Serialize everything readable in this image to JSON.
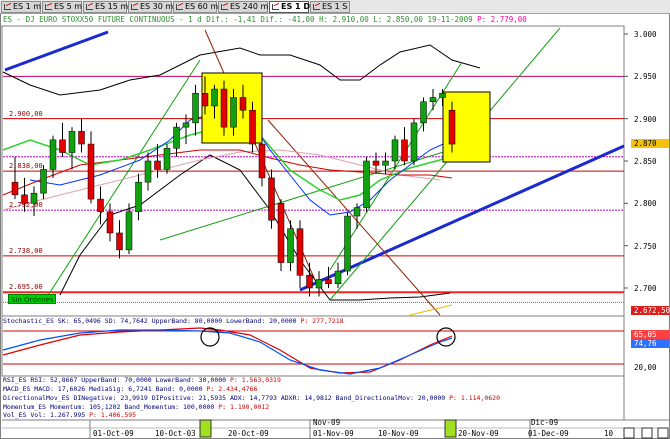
{
  "tabs": [
    {
      "label": "ES 1 m",
      "active": false
    },
    {
      "label": "ES 5 m",
      "active": false
    },
    {
      "label": "ES 15 m",
      "active": false
    },
    {
      "label": "ES 30 m",
      "active": false
    },
    {
      "label": "ES 60 m",
      "active": false
    },
    {
      "label": "ES 240 m",
      "active": false
    },
    {
      "label": "ES 1 D",
      "active": true
    },
    {
      "label": "ES 1 S",
      "active": false
    }
  ],
  "header": {
    "prefix": "ES - DJ EURO STOXX50 FUTURE CONTINUOUS - 1 d Dif.: -1,41 Dif.: -41,00 H: 2.910,00 L: 2.850,00 19-11-2009",
    "price": "P: 2.779,00"
  },
  "price_axis": {
    "labels": [
      "3.000",
      "2.950",
      "2.900",
      "2.850",
      "2.800",
      "2.750",
      "2.700"
    ],
    "tag_current": "2.870",
    "tag_low": "2.672,50",
    "current_color": "#f4c20d",
    "low_color": "#d82020"
  },
  "levels": {
    "labels": [
      "2.900,00",
      "2.838,00",
      "2.792,00",
      "2.738,00",
      "2.695,00"
    ]
  },
  "sin_ordenes": "Sin Ordenes",
  "stoch": {
    "label": "Stochastic_ES SK:",
    "sk": "65,0496",
    "sd": "SD: 74,7642",
    "upper": "UpperBand: 80,0000",
    "lower": "LowerBand: 20,0000",
    "p": "P: 277,7218",
    "tag1": "65,05",
    "tag2": "74,76"
  },
  "macd": {
    "label": "MACD_ES MACD: 17,6026 MediaSig: 6,7241 Band: 0,0000",
    "tag": "20,00",
    "p": "P: 2.434,4766"
  },
  "indicators": [
    {
      "text": "RSI_ES RSI: 52,8667 UpperBand: 70,0000 LowerBand: 30,0000",
      "p": "P: 1.563,0319"
    },
    {
      "text": "MACD_ES MACD: 17,6026 MediaSig: 6,7241 Band: 0,0000",
      "p": "P: 2.434,4766"
    },
    {
      "text": "DirectionalMov_ES DINegative: 23,9919 DIPositive: 21,5935 ADX: 14,7793 ADXR: 14,9812 Band_DirectionalMov: 20,0000",
      "p": "P: 1.114,0620"
    },
    {
      "text": "Momentum_ES Momentum: 105,1202 Band_Momentum: 100,0000",
      "p": "P: 1.190,0012"
    },
    {
      "text": "Vol_ES Vol: 1.267.995",
      "p": "P: 1.406.595"
    }
  ],
  "x_axis": {
    "dates": [
      "01-Oct-09",
      "10-Oct-03",
      "20-Oct-09",
      "01-Nov-09",
      "10-Nov-09",
      "20-Nov-09",
      "01-Dec-09",
      "10"
    ],
    "months": [
      "Nov-09",
      "Dic-09"
    ]
  },
  "chart_data": {
    "type": "candlestick",
    "title": "ES - DJ EURO STOXX50 FUTURE CONTINUOUS - 1 d",
    "ylim": [
      2665,
      3015
    ],
    "horizontal_levels": [
      2950,
      2900,
      2838,
      2792,
      2738,
      2695
    ],
    "candles": [
      {
        "o": 2825,
        "h": 2855,
        "l": 2805,
        "c": 2810
      },
      {
        "o": 2810,
        "h": 2830,
        "l": 2790,
        "c": 2800
      },
      {
        "o": 2800,
        "h": 2820,
        "l": 2785,
        "c": 2812
      },
      {
        "o": 2812,
        "h": 2845,
        "l": 2805,
        "c": 2840
      },
      {
        "o": 2840,
        "h": 2880,
        "l": 2830,
        "c": 2875
      },
      {
        "o": 2875,
        "h": 2895,
        "l": 2855,
        "c": 2860
      },
      {
        "o": 2860,
        "h": 2890,
        "l": 2840,
        "c": 2885
      },
      {
        "o": 2885,
        "h": 2900,
        "l": 2860,
        "c": 2870
      },
      {
        "o": 2870,
        "h": 2885,
        "l": 2800,
        "c": 2805
      },
      {
        "o": 2805,
        "h": 2820,
        "l": 2775,
        "c": 2790
      },
      {
        "o": 2790,
        "h": 2800,
        "l": 2755,
        "c": 2765
      },
      {
        "o": 2765,
        "h": 2780,
        "l": 2735,
        "c": 2745
      },
      {
        "o": 2745,
        "h": 2800,
        "l": 2740,
        "c": 2790
      },
      {
        "o": 2790,
        "h": 2835,
        "l": 2780,
        "c": 2825
      },
      {
        "o": 2825,
        "h": 2860,
        "l": 2815,
        "c": 2850
      },
      {
        "o": 2850,
        "h": 2870,
        "l": 2830,
        "c": 2840
      },
      {
        "o": 2840,
        "h": 2870,
        "l": 2835,
        "c": 2865
      },
      {
        "o": 2865,
        "h": 2895,
        "l": 2855,
        "c": 2890
      },
      {
        "o": 2890,
        "h": 2905,
        "l": 2870,
        "c": 2895
      },
      {
        "o": 2895,
        "h": 2940,
        "l": 2880,
        "c": 2930
      },
      {
        "o": 2930,
        "h": 2950,
        "l": 2905,
        "c": 2915
      },
      {
        "o": 2915,
        "h": 2940,
        "l": 2900,
        "c": 2935
      },
      {
        "o": 2935,
        "h": 2945,
        "l": 2880,
        "c": 2890
      },
      {
        "o": 2890,
        "h": 2935,
        "l": 2880,
        "c": 2925
      },
      {
        "o": 2925,
        "h": 2940,
        "l": 2900,
        "c": 2910
      },
      {
        "o": 2910,
        "h": 2920,
        "l": 2860,
        "c": 2870
      },
      {
        "o": 2870,
        "h": 2880,
        "l": 2820,
        "c": 2830
      },
      {
        "o": 2830,
        "h": 2840,
        "l": 2770,
        "c": 2780
      },
      {
        "o": 2800,
        "h": 2805,
        "l": 2720,
        "c": 2730
      },
      {
        "o": 2730,
        "h": 2780,
        "l": 2720,
        "c": 2770
      },
      {
        "o": 2770,
        "h": 2780,
        "l": 2700,
        "c": 2715
      },
      {
        "o": 2715,
        "h": 2730,
        "l": 2690,
        "c": 2700
      },
      {
        "o": 2700,
        "h": 2720,
        "l": 2690,
        "c": 2710
      },
      {
        "o": 2710,
        "h": 2725,
        "l": 2700,
        "c": 2705
      },
      {
        "o": 2705,
        "h": 2730,
        "l": 2700,
        "c": 2720
      },
      {
        "o": 2720,
        "h": 2790,
        "l": 2715,
        "c": 2785
      },
      {
        "o": 2785,
        "h": 2800,
        "l": 2770,
        "c": 2795
      },
      {
        "o": 2795,
        "h": 2855,
        "l": 2790,
        "c": 2850
      },
      {
        "o": 2850,
        "h": 2860,
        "l": 2835,
        "c": 2845
      },
      {
        "o": 2845,
        "h": 2860,
        "l": 2835,
        "c": 2850
      },
      {
        "o": 2850,
        "h": 2880,
        "l": 2840,
        "c": 2875
      },
      {
        "o": 2875,
        "h": 2890,
        "l": 2845,
        "c": 2850
      },
      {
        "o": 2850,
        "h": 2900,
        "l": 2845,
        "c": 2895
      },
      {
        "o": 2895,
        "h": 2925,
        "l": 2885,
        "c": 2920
      },
      {
        "o": 2920,
        "h": 2935,
        "l": 2910,
        "c": 2925
      },
      {
        "o": 2925,
        "h": 2935,
        "l": 2915,
        "c": 2930
      },
      {
        "o": 2910,
        "h": 2920,
        "l": 2860,
        "c": 2870
      }
    ]
  }
}
